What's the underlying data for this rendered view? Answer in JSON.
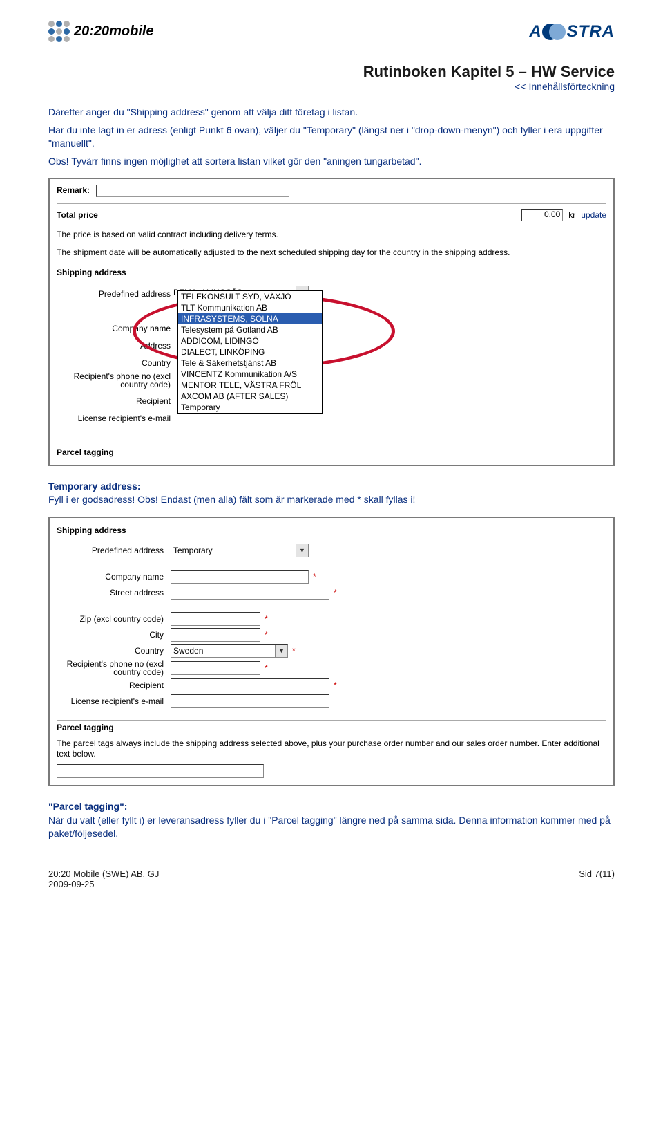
{
  "header": {
    "logo_left_text": "20:20mobile",
    "logo_right_text": "A/\\STRA"
  },
  "title": {
    "heading": "Rutinboken Kapitel 5 – HW Service",
    "toc_link": "<< Innehållsförteckning"
  },
  "intro": {
    "p1": "Därefter anger du \"Shipping address\" genom att välja ditt företag i listan.",
    "p2": "Har du inte lagt in er adress (enligt Punkt 6 ovan), väljer du \"Temporary\" (längst ner i \"drop-down-menyn\") och fyller i era uppgifter \"manuellt\".",
    "p3": "Obs! Tyvärr finns ingen möjlighet att sortera listan vilket gör den \"aningen tungarbetad\"."
  },
  "screenshot1": {
    "remark_label": "Remark:",
    "total_price_label": "Total price",
    "total_price_value": "0.00",
    "currency": "kr",
    "update_label": "update",
    "note1": "The price is based on valid contract including delivery terms.",
    "note2": "The shipment date will be automatically adjusted to the next scheduled shipping day for the country in the shipping address.",
    "shipping_heading": "Shipping address",
    "predefined_label": "Predefined address",
    "company_label": "Company name",
    "address_label": "Address",
    "country_label": "Country",
    "phone_label": "Recipient's phone no (excl country code)",
    "recipient_label": "Recipient",
    "email_label": "License recipient's e-mail",
    "dropdown_top": "PEMA, ALINGSÅS",
    "options": [
      "TELEKONSULT SYD, VÄXJÖ",
      "TLT Kommunikation AB",
      "INFRASYSTEMS, SOLNA",
      "Telesystem på Gotland AB",
      "ADDICOM, LIDINGÖ",
      "DIALECT, LINKÖPING",
      "Tele & Säkerhetstjänst AB",
      "VINCENTZ Kommunikation A/S",
      "MENTOR TELE, VÄSTRA FRÖL",
      "AXCOM AB (AFTER SALES)",
      "Temporary"
    ],
    "parcel_heading": "Parcel tagging"
  },
  "temp_section": {
    "heading": "Temporary address:",
    "text": "Fyll i er godsadress! Obs! Endast (men alla) fält som är markerade med * skall fyllas i!"
  },
  "screenshot2": {
    "shipping_heading": "Shipping address",
    "predefined_label": "Predefined address",
    "predefined_value": "Temporary",
    "company_label": "Company name",
    "street_label": "Street address",
    "zip_label": "Zip (excl country code)",
    "city_label": "City",
    "country_label": "Country",
    "country_value": "Sweden",
    "phone_label": "Recipient's phone no (excl country code)",
    "recipient_label": "Recipient",
    "email_label": "License recipient's e-mail",
    "parcel_heading": "Parcel tagging",
    "parcel_note": "The parcel tags always include the shipping address selected above, plus your purchase order number and our sales order number. Enter additional text below."
  },
  "parcel_section": {
    "heading": "\"Parcel tagging\":",
    "text": "När du valt (eller fyllt i) er leveransadress fyller du i \"Parcel tagging\" längre ned på samma sida. Denna information kommer med på paket/följesedel."
  },
  "footer": {
    "left_line1": "20:20 Mobile (SWE) AB, GJ",
    "left_line2": "2009-09-25",
    "right": "Sid 7(11)"
  }
}
